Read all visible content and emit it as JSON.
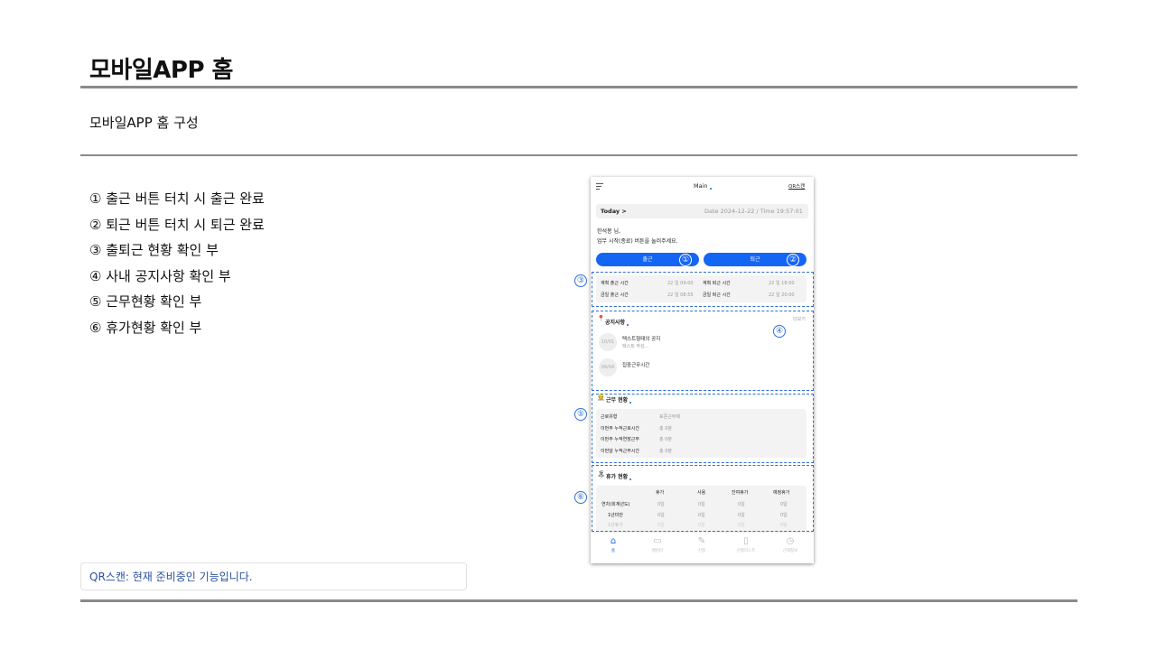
{
  "slide": {
    "title": "모바일APP 홈",
    "subtitle": "모바일APP 홈 구성",
    "legend": [
      "① 출근 버튼 터치 시 출근 완료",
      "② 퇴근 버튼 터치 시 퇴근 완료",
      "③ 출퇴근 현황 확인 부",
      "④ 사내 공지사항 확인 부",
      "⑤ 근무현황 확인 부",
      "⑥ 휴가현황 확인 부"
    ],
    "note": "QR스캔: 현재 준비중인 기능입니다.",
    "callouts": [
      "③",
      "④",
      "⑤",
      "⑥"
    ]
  },
  "phone": {
    "header_title": "Main",
    "qr_link": "QR스캔",
    "today_label": "Today >",
    "today_info": "Date 2024-12-22  /  Time 19:57:01",
    "greeting_name": "한석봉 님,",
    "greeting_msg": "업무 시작(종료) 버튼을 눌러주세요.",
    "checkin_label": "출근",
    "checkout_label": "퇴근",
    "checkin_badge": "①",
    "checkout_badge": "②",
    "attendance": {
      "plan_in_label": "계획 출근 시간",
      "plan_in_value": "22 일 09:00",
      "plan_out_label": "계획 퇴근 시간",
      "plan_out_value": "22 일 18:00",
      "today_in_label": "금일 출근 시간",
      "today_in_value": "22 일 08:55",
      "today_out_label": "금일 퇴근 시간",
      "today_out_value": "22 일 20:00"
    },
    "notice": {
      "title": "공지사항",
      "more": "더보기",
      "items": [
        {
          "date": "10/01",
          "title": "텍스트형태의 공지",
          "sub": "텍스트 작성..."
        },
        {
          "date": "06/04",
          "title": "집중근무시간",
          "sub": ""
        }
      ]
    },
    "work": {
      "title": "근무 현황",
      "rows": [
        {
          "label": "근로유형",
          "value": "표준근무제"
        },
        {
          "label": "이번주 누적근로시간",
          "value": "총 0분"
        },
        {
          "label": "이번주 누적연장근무",
          "value": "총 0분"
        },
        {
          "label": "이번달 누적근무시간",
          "value": "총 0분"
        }
      ]
    },
    "leave": {
      "title": "휴가 현황",
      "headers": [
        "휴가",
        "사용",
        "잔여휴가",
        "예정휴가"
      ],
      "rows": [
        {
          "label": "연차(회계년도)",
          "values": [
            "0일",
            "0일",
            "0일",
            "0일"
          ]
        },
        {
          "label": "1년미만",
          "values": [
            "0일",
            "0일",
            "0일",
            "0일"
          ]
        },
        {
          "label": "1년휴가",
          "values": [
            "0일",
            "0일",
            "0일",
            "0일"
          ]
        }
      ]
    },
    "tabs": [
      {
        "label": "홈",
        "icon": "home-icon"
      },
      {
        "label": "캘린더",
        "icon": "calendar-icon"
      },
      {
        "label": "신청",
        "icon": "pencil-icon"
      },
      {
        "label": "신청리스트",
        "icon": "document-icon"
      },
      {
        "label": "근태정보",
        "icon": "clock-icon"
      }
    ]
  }
}
